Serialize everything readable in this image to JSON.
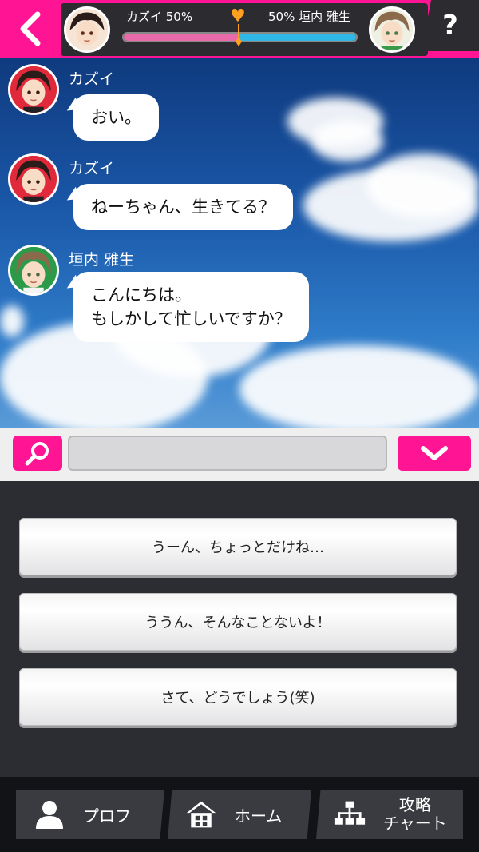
{
  "header": {
    "left_character": {
      "name": "カズイ",
      "percent_text": "50%",
      "label": "カズイ 50%"
    },
    "right_character": {
      "name": "垣内 雅生",
      "percent_text": "50%",
      "label": "50% 垣内 雅生"
    },
    "affinity_gauge": {
      "left_share": 0.5,
      "right_share": 0.5
    },
    "help_label": "?"
  },
  "messages": [
    {
      "sender": "カズイ",
      "avatar": "kazui-avatar",
      "text": "おい。"
    },
    {
      "sender": "カズイ",
      "avatar": "kazui-avatar",
      "text": "ねーちゃん、生きてる？"
    },
    {
      "sender": "垣内 雅生",
      "avatar": "kakiuchi-avatar",
      "text": "こんにちは。\nもしかして忙しいですか？"
    }
  ],
  "input": {
    "value": "",
    "placeholder": ""
  },
  "choices": [
    {
      "label": "うーん、ちょっとだけね…"
    },
    {
      "label": "ううん、そんなことないよ！"
    },
    {
      "label": "さて、どうでしょう(笑)"
    }
  ],
  "nav": {
    "profile_label": "プロフ",
    "home_label": "ホーム",
    "chart_label": "攻略\nチャート"
  },
  "colors": {
    "accent": "#ff1493",
    "gauge_left": "#e86aa8",
    "gauge_right": "#2fb8e6",
    "heart": "#ffa020"
  },
  "icons": [
    "back-chevron-icon",
    "help-icon",
    "heart-icon",
    "search-icon",
    "chevron-down-icon",
    "person-icon",
    "house-icon",
    "flowchart-icon"
  ]
}
